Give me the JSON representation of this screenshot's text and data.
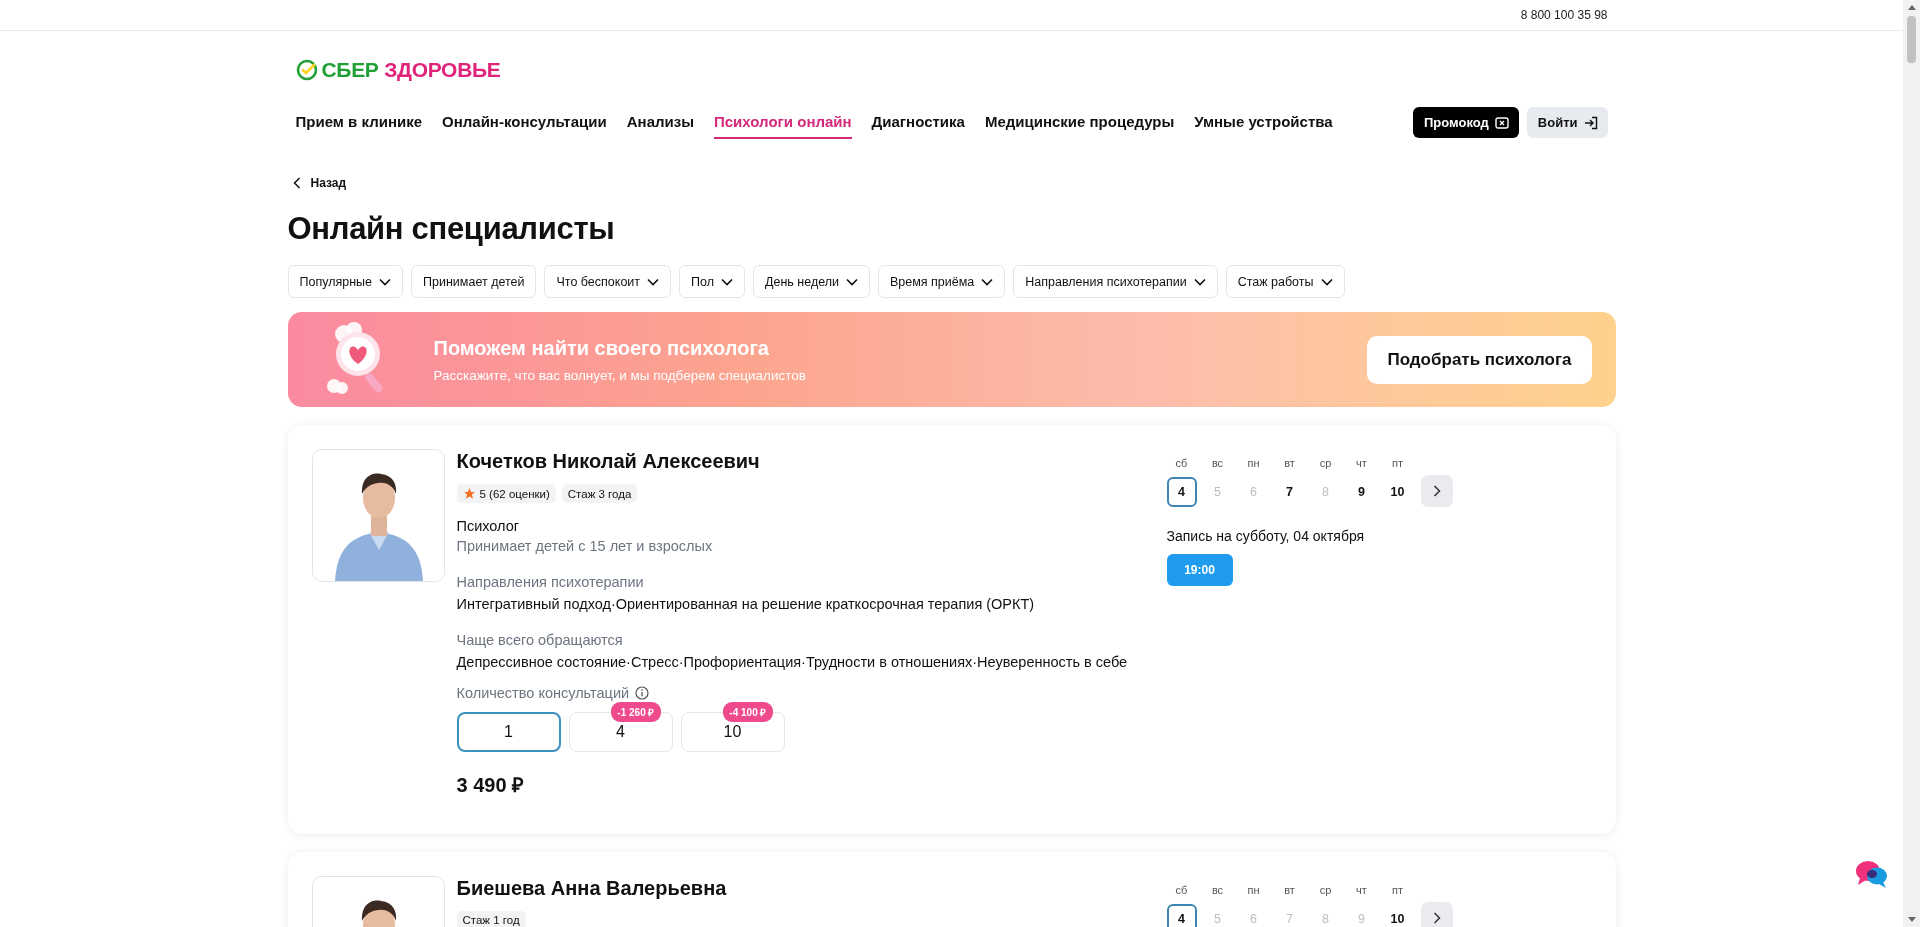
{
  "topbar": {
    "phone": "8 800 100 35 98"
  },
  "logo": {
    "first": "СБЕР",
    "second": "ЗДОРОВЬЕ"
  },
  "nav": [
    {
      "label": "Прием в клинике",
      "selected": false
    },
    {
      "label": "Онлайн-консультации",
      "selected": false
    },
    {
      "label": "Анализы",
      "selected": false
    },
    {
      "label": "Психологи онлайн",
      "selected": true
    },
    {
      "label": "Диагностика",
      "selected": false
    },
    {
      "label": "Медицинские процедуры",
      "selected": false
    },
    {
      "label": "Умные устройства",
      "selected": false
    }
  ],
  "header_buttons": [
    {
      "label": "Промокод",
      "kind": "promo"
    },
    {
      "label": "Войти",
      "kind": "login"
    }
  ],
  "back": "Назад",
  "title": "Онлайн специалисты",
  "filters": [
    {
      "label": "Популярные",
      "dropdown": true
    },
    {
      "label": "Принимает детей",
      "dropdown": false
    },
    {
      "label": "Что беспокоит",
      "dropdown": true
    },
    {
      "label": "Пол",
      "dropdown": true
    },
    {
      "label": "День недели",
      "dropdown": true
    },
    {
      "label": "Время приёма",
      "dropdown": true
    },
    {
      "label": "Направления психотерапии",
      "dropdown": true
    },
    {
      "label": "Стаж работы",
      "dropdown": true
    }
  ],
  "banner": {
    "title": "Поможем найти своего психолога",
    "subtitle": "Расскажите, что вас волнует, и мы подберем специалистов",
    "button": "Подобрать психолога"
  },
  "specialists": [
    {
      "name": "Кочетков Николай Алексеевич",
      "rating": "5 (62 оценки)",
      "experience": "Стаж 3 года",
      "role": "Психолог",
      "age_note": "Принимает детей с 15 лет и взрослых",
      "directions_label": "Направления психотерапии",
      "directions": "Интегративный подход·Ориентированная на решение краткосрочная терапия (ОРКТ)",
      "concerns_label": "Чаще всего обращаются",
      "concerns": "Депрессивное состояние·Стресс·Профориентация·Трудности в отношениях·Неуверенность в себе",
      "consult_label": "Количество консультаций",
      "packages": [
        {
          "count": "1",
          "selected": true
        },
        {
          "count": "4",
          "discount": "-1 260 ₽",
          "selected": false
        },
        {
          "count": "10",
          "discount": "-4 100 ₽",
          "selected": false
        }
      ],
      "price": "3 490 ₽",
      "calendar": {
        "days": [
          {
            "weekday": "сб",
            "day": "4",
            "available": true,
            "selected": true
          },
          {
            "weekday": "вс",
            "day": "5",
            "available": false,
            "selected": false
          },
          {
            "weekday": "пн",
            "day": "6",
            "available": false,
            "selected": false
          },
          {
            "weekday": "вт",
            "day": "7",
            "available": true,
            "selected": false
          },
          {
            "weekday": "ср",
            "day": "8",
            "available": false,
            "selected": false
          },
          {
            "weekday": "чт",
            "day": "9",
            "available": true,
            "selected": false
          },
          {
            "weekday": "пт",
            "day": "10",
            "available": true,
            "selected": false
          }
        ],
        "booking_label": "Запись на субботу, 04 октября",
        "slots": [
          "19:00"
        ]
      }
    },
    {
      "name": "Биешева Анна Валерьевна",
      "experience": "Стаж 1 год",
      "calendar": {
        "days": [
          {
            "weekday": "сб",
            "day": "4",
            "available": true,
            "selected": true
          },
          {
            "weekday": "вс",
            "day": "5",
            "available": false,
            "selected": false
          },
          {
            "weekday": "пн",
            "day": "6",
            "available": false,
            "selected": false
          },
          {
            "weekday": "вт",
            "day": "7",
            "available": false,
            "selected": false
          },
          {
            "weekday": "ср",
            "day": "8",
            "available": false,
            "selected": false
          },
          {
            "weekday": "чт",
            "day": "9",
            "available": false,
            "selected": false
          },
          {
            "weekday": "пт",
            "day": "10",
            "available": true,
            "selected": false
          }
        ]
      }
    }
  ]
}
